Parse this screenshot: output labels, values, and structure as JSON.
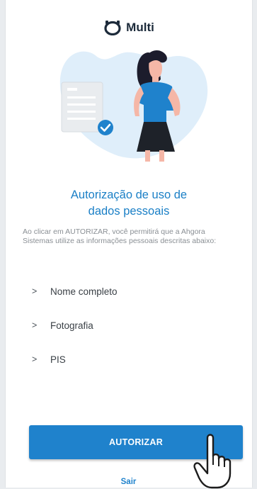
{
  "app": {
    "logo_text": "Multi"
  },
  "content": {
    "title_line1": "Autorização de uso de",
    "title_line2": "dados pessoais",
    "description": "Ao clicar em AUTORIZAR, você permitirá que a Ahgora Sistemas utilize as informações pessoais descritas abaixo:",
    "permissions": [
      {
        "chevron": ">",
        "label": "Nome completo"
      },
      {
        "chevron": ">",
        "label": "Fotografia"
      },
      {
        "chevron": ">",
        "label": "PIS"
      }
    ]
  },
  "actions": {
    "authorize_label": "AUTORIZAR",
    "exit_label": "Sair"
  },
  "colors": {
    "accent": "#1f82cc",
    "title": "#1a7fc6",
    "blob": "#dfeefa"
  }
}
